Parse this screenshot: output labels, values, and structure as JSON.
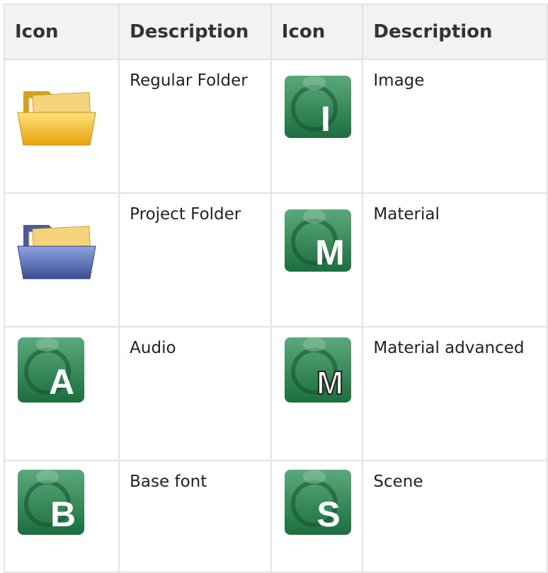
{
  "headers": [
    "Icon",
    "Description",
    "Icon",
    "Description"
  ],
  "rows": [
    {
      "left": {
        "icon": "folder-yellow-icon",
        "description": "Regular Folder"
      },
      "right": {
        "icon": "image-asset-icon",
        "letter": "I",
        "description": "Image"
      }
    },
    {
      "left": {
        "icon": "folder-blue-icon",
        "description": "Project Folder"
      },
      "right": {
        "icon": "material-asset-icon",
        "letter": "M",
        "description": "Material"
      }
    },
    {
      "left": {
        "icon": "audio-asset-icon",
        "letter": "A",
        "description": "Audio"
      },
      "right": {
        "icon": "material-advanced-asset-icon",
        "letter": "M",
        "description": "Material advanced"
      }
    },
    {
      "left": {
        "icon": "base-font-asset-icon",
        "letter": "B",
        "description": "Base font"
      },
      "right": {
        "icon": "scene-asset-icon",
        "letter": "S",
        "description": "Scene"
      }
    }
  ],
  "colors": {
    "header_bg": "#f2f2f2",
    "border": "#e3e3e3",
    "asset_green": "#1f7a45",
    "folder_yellow": "#f3bb1f",
    "folder_blue": "#5366a8"
  }
}
